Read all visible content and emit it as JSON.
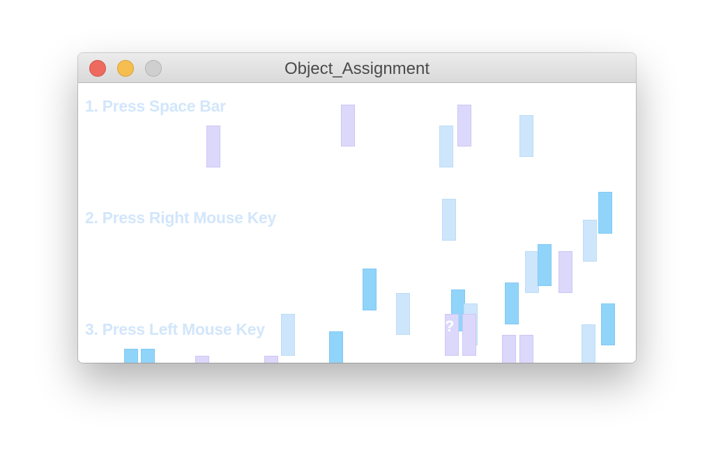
{
  "window": {
    "title": "Object_Assignment"
  },
  "titlebar_buttons": {
    "close": "close-button",
    "minimize": "minimize-button",
    "zoom": "zoom-button"
  },
  "instructions": {
    "step1": "1. Press Space Bar",
    "step2": "2. Press Right Mouse Key",
    "step3": "3. Press Left Mouse Key"
  },
  "marker": "?",
  "colors": {
    "close": "#ee6a5f",
    "minimize": "#f5be4f",
    "zoom": "#cfcfcf",
    "instruction_text": "#d2e6fb",
    "block_blue": "#91d4fa",
    "block_light_blue": "#cde6fb",
    "block_lavender": "#dcd8fb"
  }
}
